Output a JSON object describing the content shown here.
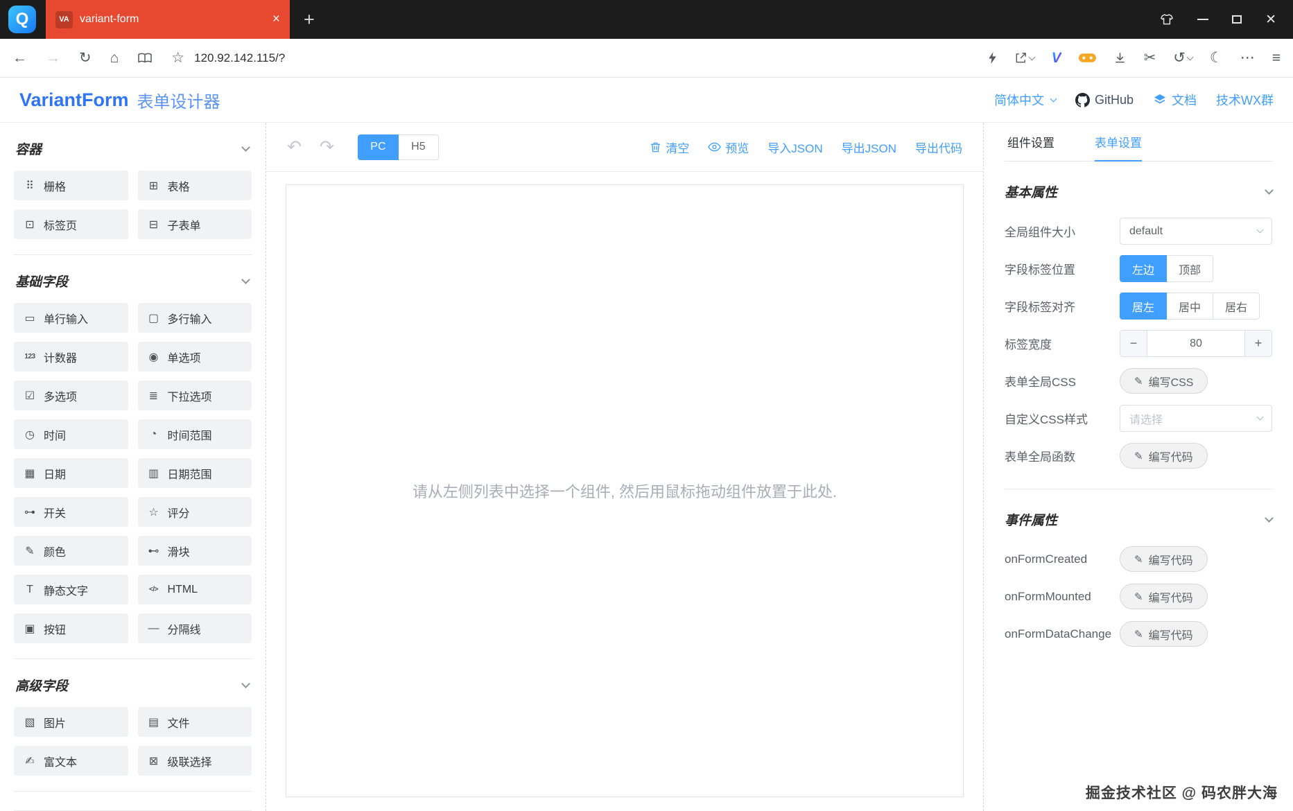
{
  "browser": {
    "tab_favicon": "VA",
    "tab_title": "variant-form",
    "url": "120.92.142.115/?"
  },
  "header": {
    "brand": "VariantForm",
    "subtitle": "表单设计器",
    "lang": "简体中文",
    "github": "GitHub",
    "docs": "文档",
    "wx_group": "技术WX群"
  },
  "sidebar": {
    "sections": [
      {
        "title": "容器",
        "items": [
          {
            "name": "grid",
            "label": "栅格",
            "icon": "grid-icon",
            "glyph": "⠿"
          },
          {
            "name": "table",
            "label": "表格",
            "icon": "table-icon",
            "glyph": "⊞"
          },
          {
            "name": "tab",
            "label": "标签页",
            "icon": "tab-icon",
            "glyph": "⊡"
          },
          {
            "name": "subform",
            "label": "子表单",
            "icon": "subform-icon",
            "glyph": "⊟"
          }
        ]
      },
      {
        "title": "基础字段",
        "items": [
          {
            "name": "input",
            "label": "单行输入",
            "icon": "input-icon",
            "glyph": "▭"
          },
          {
            "name": "textarea",
            "label": "多行输入",
            "icon": "textarea-icon",
            "glyph": "▢"
          },
          {
            "name": "number",
            "label": "计数器",
            "icon": "number-icon",
            "glyph": "123"
          },
          {
            "name": "radio",
            "label": "单选项",
            "icon": "radio-icon",
            "glyph": "◉"
          },
          {
            "name": "checkbox",
            "label": "多选项",
            "icon": "checkbox-icon",
            "glyph": "☑"
          },
          {
            "name": "select",
            "label": "下拉选项",
            "icon": "select-icon",
            "glyph": "≣"
          },
          {
            "name": "time",
            "label": "时间",
            "icon": "time-icon",
            "glyph": "◷"
          },
          {
            "name": "time-range",
            "label": "时间范围",
            "icon": "time-range-icon",
            "glyph": "◔"
          },
          {
            "name": "date",
            "label": "日期",
            "icon": "date-icon",
            "glyph": "▦"
          },
          {
            "name": "date-range",
            "label": "日期范围",
            "icon": "date-range-icon",
            "glyph": "▥"
          },
          {
            "name": "switch",
            "label": "开关",
            "icon": "switch-icon",
            "glyph": "⊶"
          },
          {
            "name": "rate",
            "label": "评分",
            "icon": "rate-icon",
            "glyph": "☆"
          },
          {
            "name": "color",
            "label": "颜色",
            "icon": "color-icon",
            "glyph": "✎"
          },
          {
            "name": "slider",
            "label": "滑块",
            "icon": "slider-icon",
            "glyph": "⊷"
          },
          {
            "name": "static-text",
            "label": "静态文字",
            "icon": "static-text-icon",
            "glyph": "T"
          },
          {
            "name": "html",
            "label": "HTML",
            "icon": "html-icon",
            "glyph": "</>"
          },
          {
            "name": "button",
            "label": "按钮",
            "icon": "button-icon",
            "glyph": "▣"
          },
          {
            "name": "divider",
            "label": "分隔线",
            "icon": "divider-icon",
            "glyph": "—"
          }
        ]
      },
      {
        "title": "高级字段",
        "items": [
          {
            "name": "picture-upload",
            "label": "图片",
            "icon": "picture-icon",
            "glyph": "▧"
          },
          {
            "name": "file-upload",
            "label": "文件",
            "icon": "file-icon",
            "glyph": "▤"
          },
          {
            "name": "rich-editor",
            "label": "富文本",
            "icon": "rich-text-icon",
            "glyph": "✍"
          },
          {
            "name": "cascader",
            "label": "级联选择",
            "icon": "cascader-icon",
            "glyph": "⊠"
          }
        ]
      }
    ]
  },
  "toolbar": {
    "devices": [
      {
        "label": "PC",
        "active": true
      },
      {
        "label": "H5",
        "active": false
      }
    ],
    "actions": [
      {
        "label": "清空",
        "icon": "trash-icon"
      },
      {
        "label": "预览",
        "icon": "eye-icon"
      },
      {
        "label": "导入JSON"
      },
      {
        "label": "导出JSON"
      },
      {
        "label": "导出代码"
      }
    ]
  },
  "canvas": {
    "placeholder": "请从左侧列表中选择一个组件, 然后用鼠标拖动组件放置于此处."
  },
  "settings": {
    "tabs": [
      {
        "label": "组件设置",
        "active": false
      },
      {
        "label": "表单设置",
        "active": true
      }
    ],
    "basic": {
      "title": "基本属性",
      "widget_size": {
        "label": "全局组件大小",
        "value": "default"
      },
      "label_position": {
        "label": "字段标签位置",
        "options": [
          "左边",
          "顶部"
        ],
        "active": "左边"
      },
      "label_align": {
        "label": "字段标签对齐",
        "options": [
          "居左",
          "居中",
          "居右"
        ],
        "active": "居左"
      },
      "label_width": {
        "label": "标签宽度",
        "value": "80"
      },
      "form_css": {
        "label": "表单全局CSS",
        "button": "编写CSS"
      },
      "custom_class": {
        "label": "自定义CSS样式",
        "placeholder": "请选择"
      },
      "global_functions": {
        "label": "表单全局函数",
        "button": "编写代码"
      }
    },
    "events": {
      "title": "事件属性",
      "items": [
        {
          "label": "onFormCreated",
          "button": "编写代码"
        },
        {
          "label": "onFormMounted",
          "button": "编写代码"
        },
        {
          "label": "onFormDataChange",
          "button": "编写代码"
        }
      ]
    }
  },
  "watermark": "掘金技术社区 @ 码农胖大海"
}
